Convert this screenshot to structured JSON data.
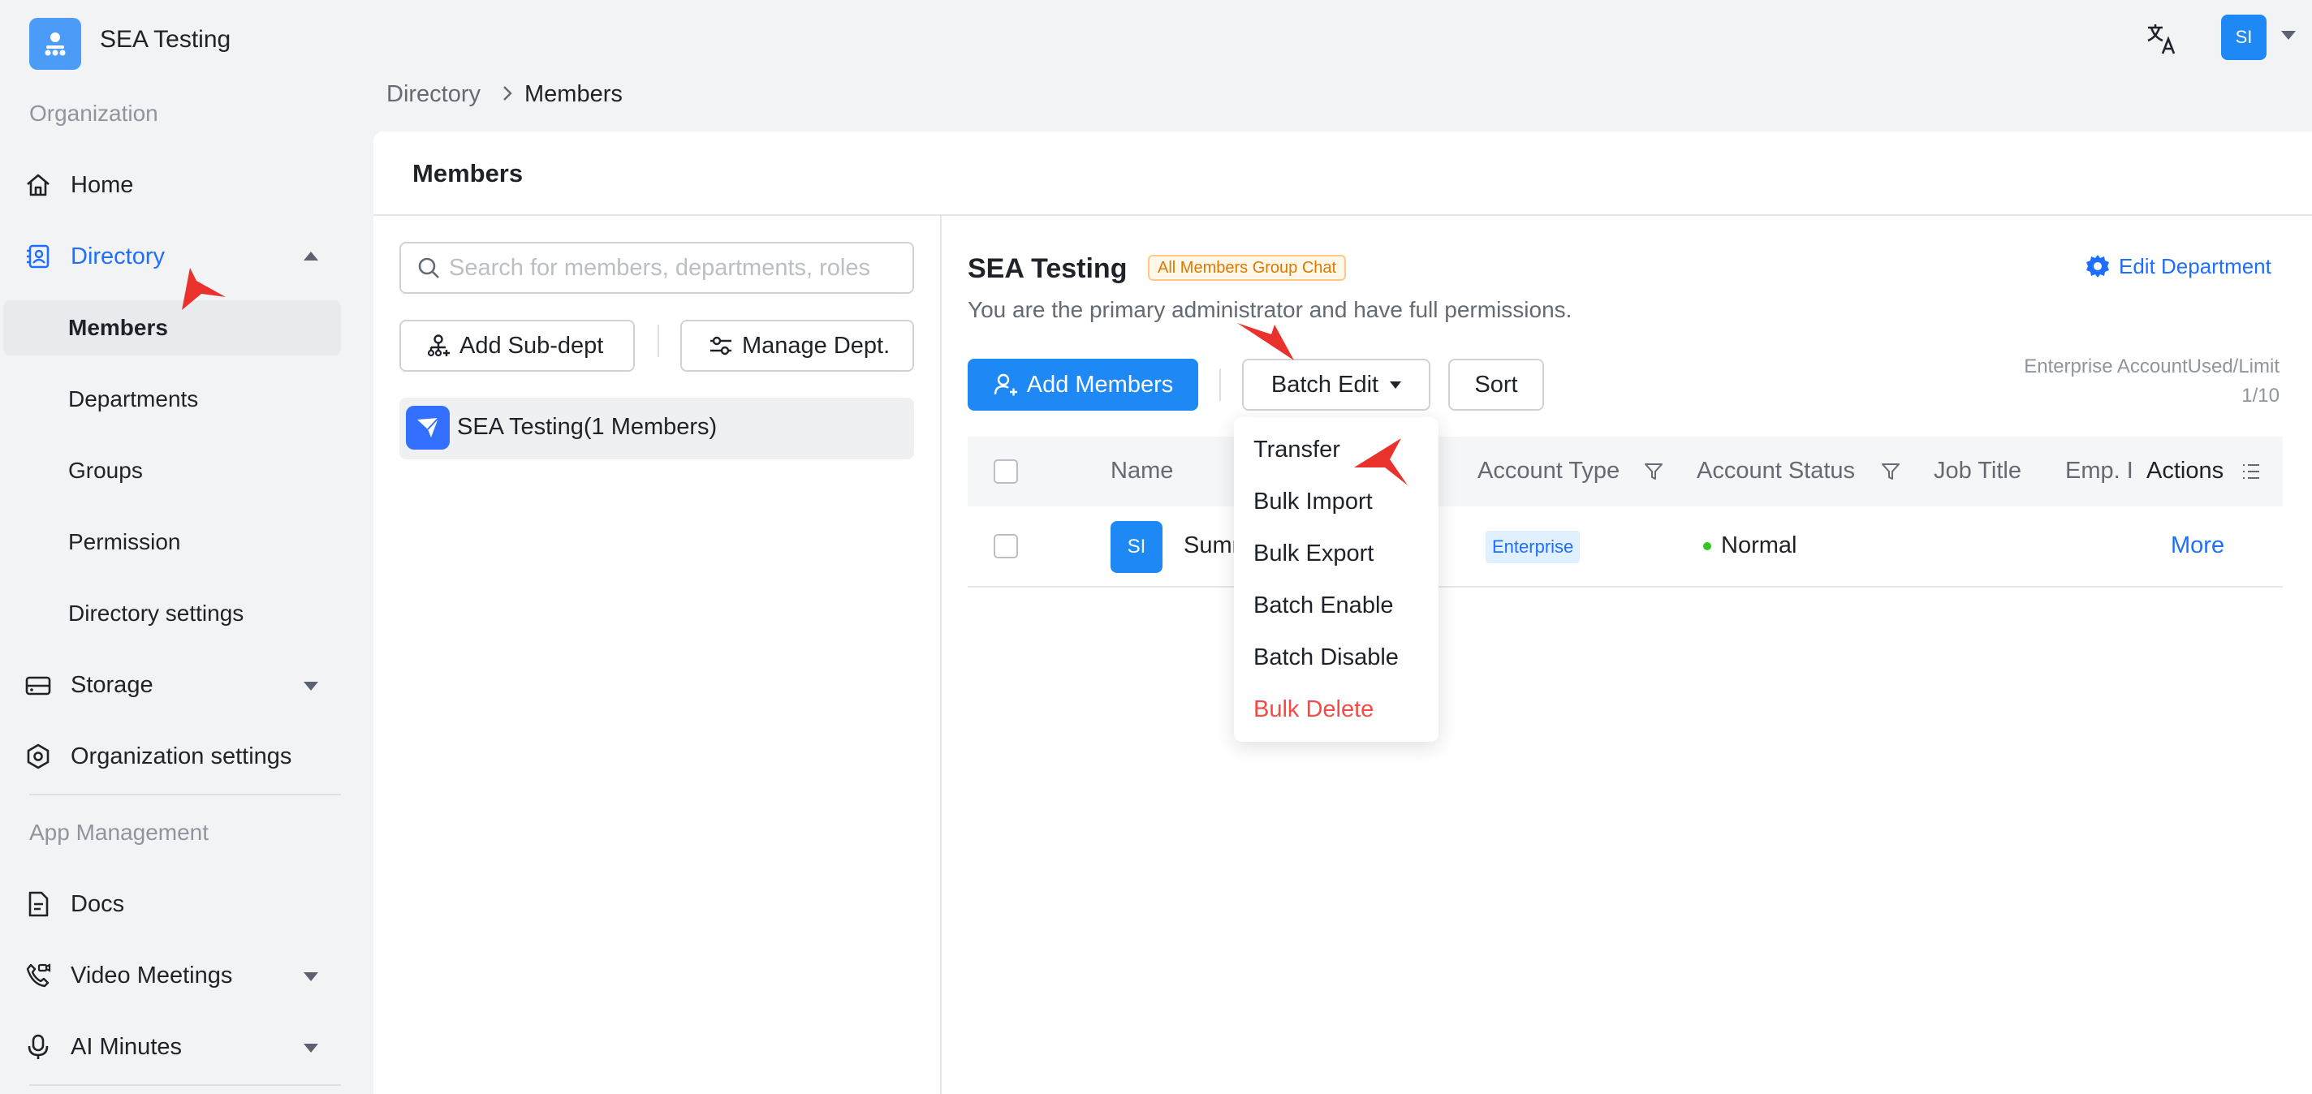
{
  "header": {
    "app_name": "SEA Testing",
    "user_initials": "SI",
    "icons": [
      "org-logo-icon",
      "translate-icon",
      "chevron-down-icon"
    ]
  },
  "sidebar": {
    "section_organization": "Organization",
    "section_apps": "App Management",
    "items": {
      "home": "Home",
      "directory": "Directory",
      "members": "Members",
      "departments": "Departments",
      "groups": "Groups",
      "permission": "Permission",
      "directory_settings": "Directory settings",
      "storage": "Storage",
      "organization_settings": "Organization settings",
      "docs": "Docs",
      "video_meetings": "Video Meetings",
      "ai_minutes": "AI Minutes"
    },
    "active_item": "Members"
  },
  "breadcrumb": {
    "parent": "Directory",
    "current": "Members"
  },
  "card": {
    "title": "Members"
  },
  "left_pane": {
    "search_placeholder": "Search for members, departments, roles",
    "add_subdept": "Add Sub-dept",
    "manage_dept": "Manage Dept.",
    "dept_label": "SEA Testing(1 Members)"
  },
  "right_pane": {
    "org_title": "SEA Testing",
    "group_chat_tag": "All Members Group Chat",
    "permission_text": "You are the primary administrator and have full permissions.",
    "edit_department": "Edit Department",
    "add_members": "Add Members",
    "batch_edit": "Batch Edit",
    "sort": "Sort",
    "quota_label": "Enterprise AccountUsed/Limit",
    "quota_value": "1/10"
  },
  "table": {
    "columns": {
      "name": "Name",
      "account_type": "Account Type",
      "account_status": "Account Status",
      "job_title": "Job Title",
      "emp_id": "Emp. I",
      "actions": "Actions"
    },
    "rows": [
      {
        "initials": "SI",
        "name": "Summ",
        "name_tail": "n",
        "account_type": "Enterprise",
        "status": "Normal",
        "action": "More"
      }
    ]
  },
  "batch_menu": {
    "items": [
      "Transfer",
      "Bulk Import",
      "Bulk Export",
      "Batch Enable",
      "Batch Disable",
      "Bulk Delete"
    ],
    "danger_item": "Bulk Delete"
  },
  "colors": {
    "primary": "#1e88f5",
    "link": "#1e6fff",
    "danger": "#f54a45",
    "tag_orange": "#de7802",
    "status_green": "#34c724",
    "annotation_arrow": "#e8322b"
  }
}
